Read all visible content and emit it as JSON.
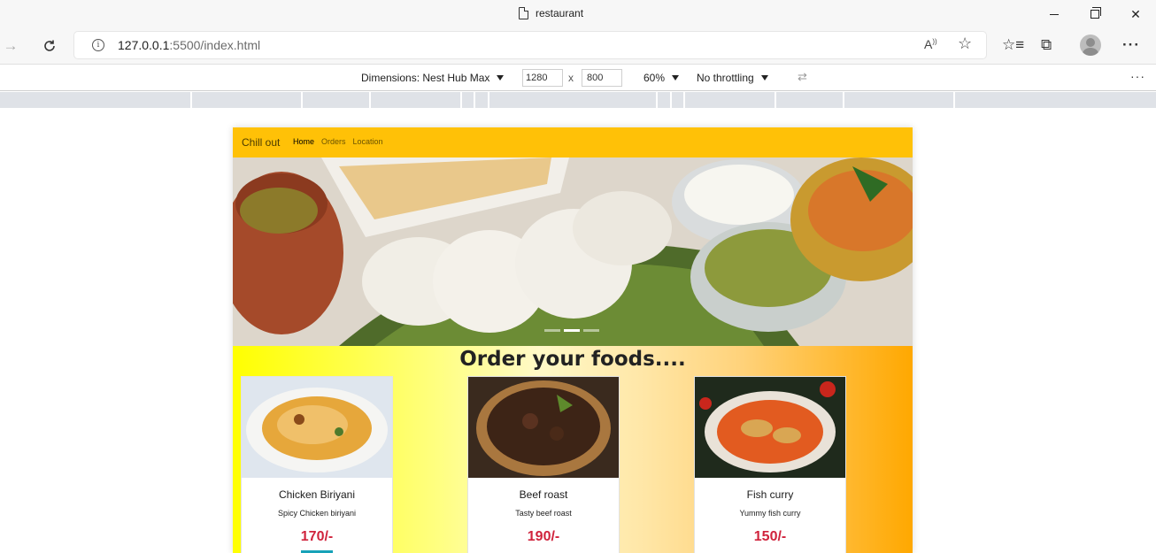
{
  "browser": {
    "tab_title": "restaurant",
    "url_host": "127.0.0.1",
    "url_rest": ":5500/index.html"
  },
  "devtools": {
    "dimensions_label": "Dimensions: Nest Hub Max",
    "width_value": "1280",
    "times": "x",
    "height_value": "800",
    "zoom": "60%",
    "throttling": "No throttling"
  },
  "site": {
    "brand": "Chill out",
    "nav_links": [
      "Home",
      "Orders",
      "Location"
    ],
    "section_title": "Order your foods....",
    "cards": [
      {
        "name": "Chicken Biriyani",
        "desc": "Spicy Chicken biriyani",
        "price": "170/-"
      },
      {
        "name": "Beef roast",
        "desc": "Tasty beef roast",
        "price": "190/-"
      },
      {
        "name": "Fish curry",
        "desc": "Yummy fish curry",
        "price": "150/-"
      }
    ]
  },
  "colors": {
    "navbar": "#ffc107",
    "price": "#d0233c",
    "button": "#17a2b8"
  }
}
